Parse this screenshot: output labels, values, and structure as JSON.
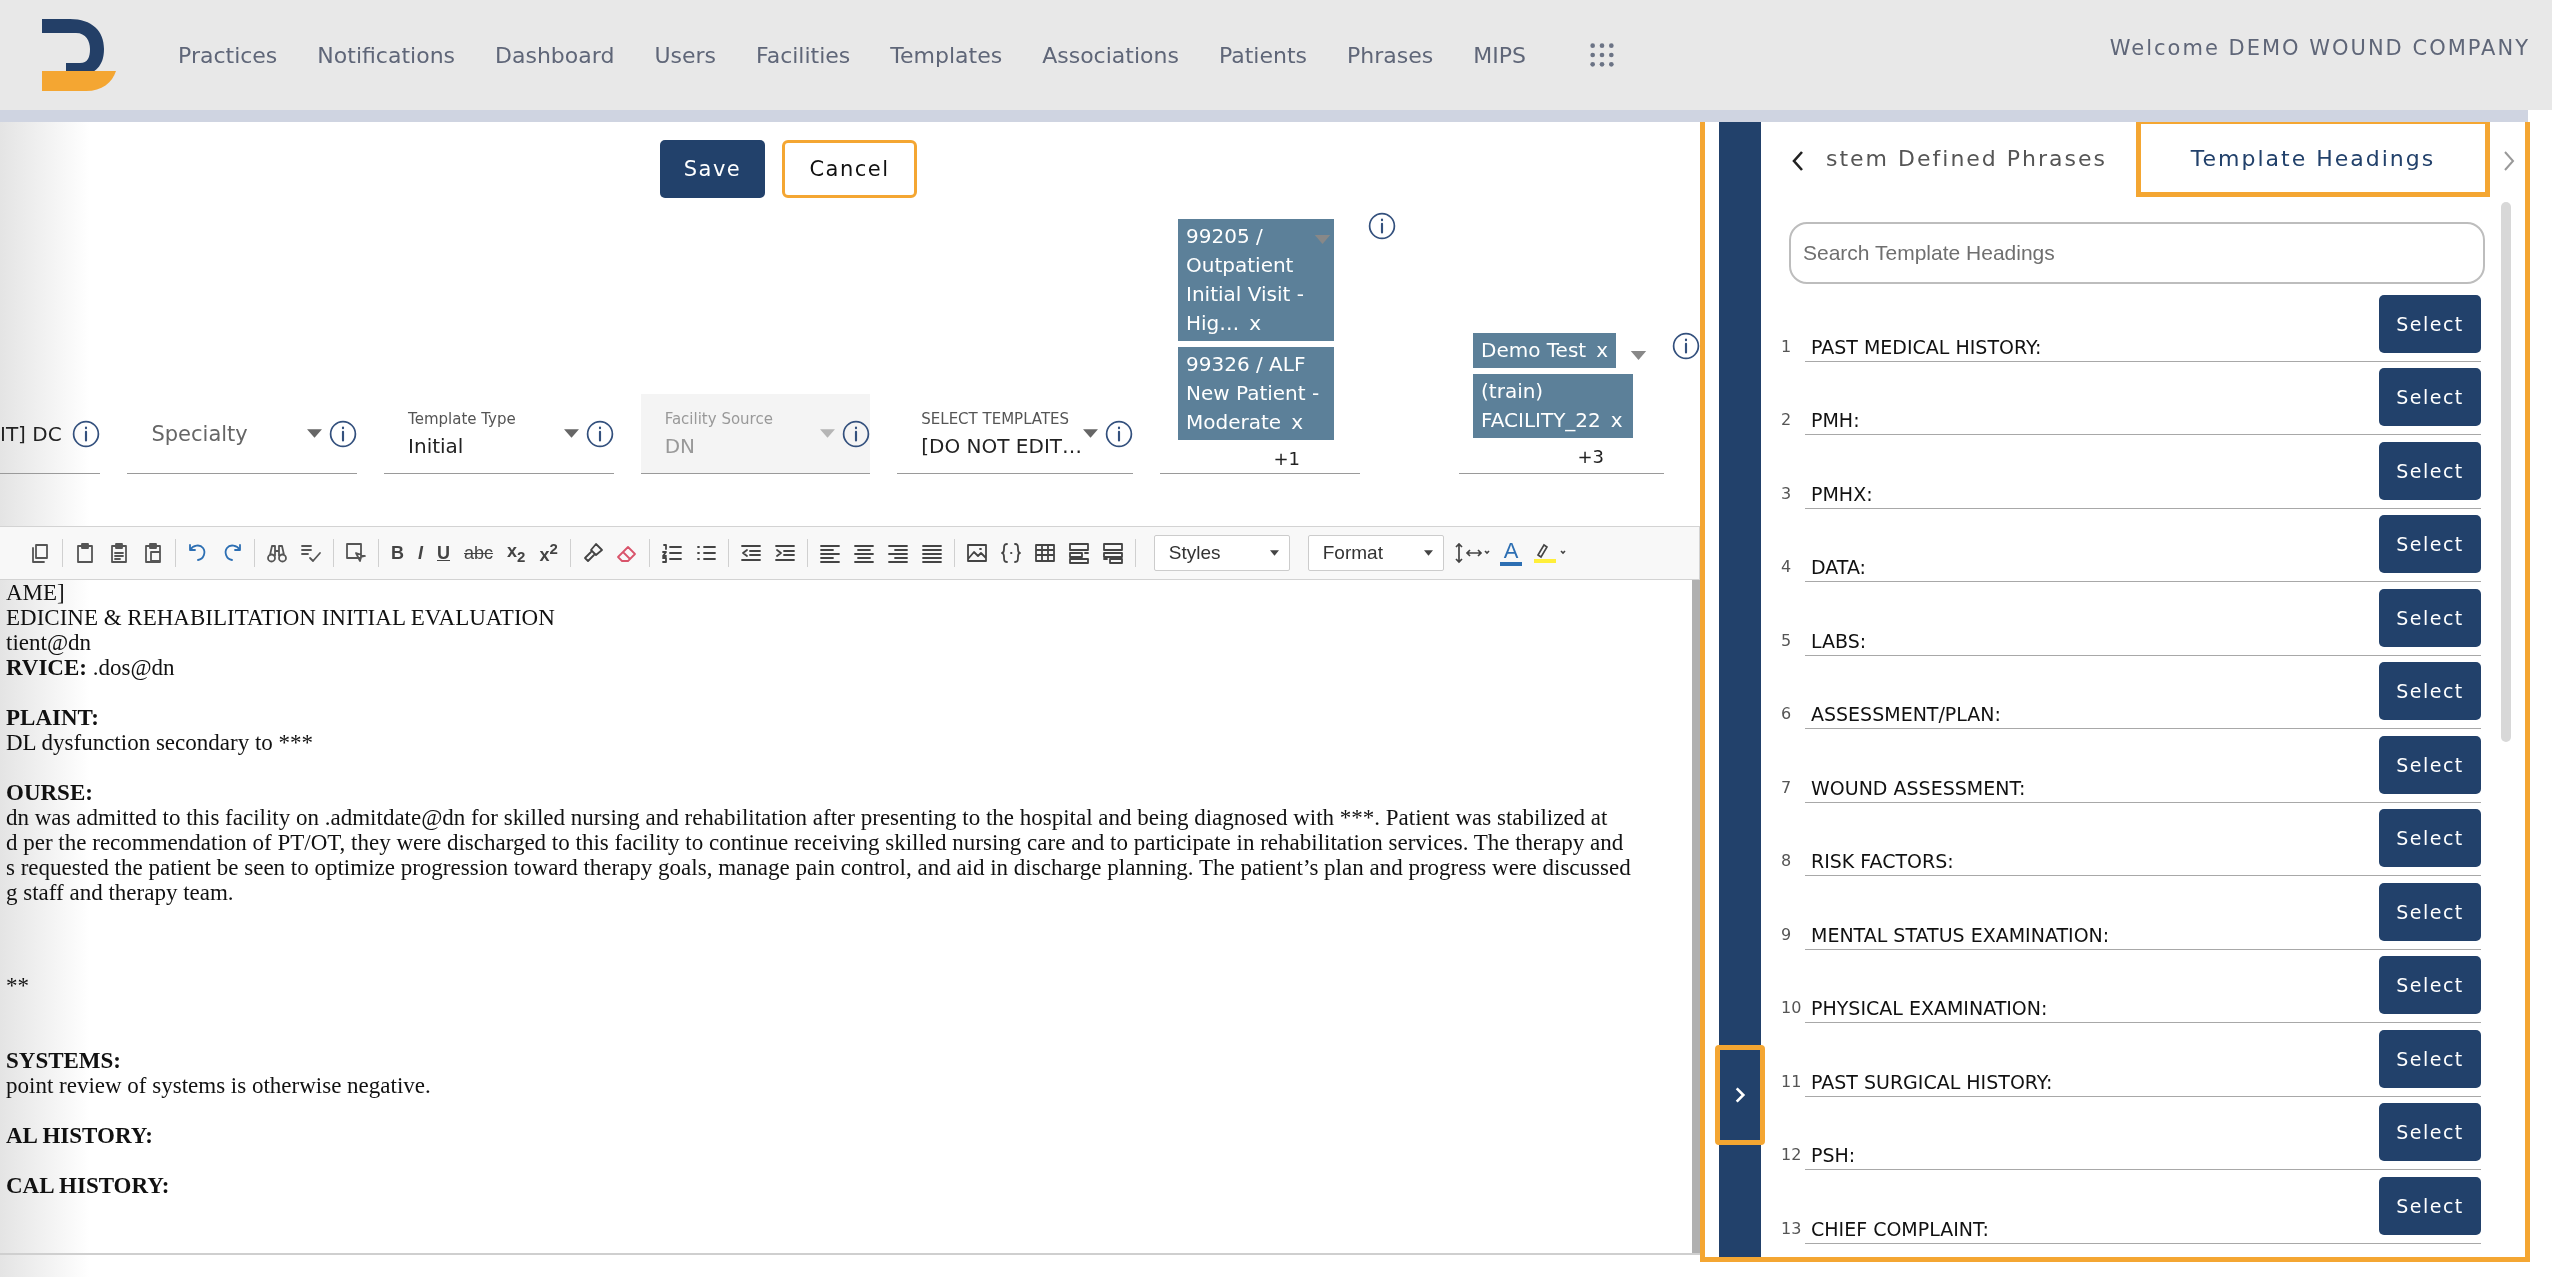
{
  "header": {
    "nav": [
      "Practices",
      "Notifications",
      "Dashboard",
      "Users",
      "Facilities",
      "Templates",
      "Associations",
      "Patients",
      "Phrases",
      "MIPS"
    ],
    "welcome": "Welcome DEMO WOUND COMPANY"
  },
  "actions": {
    "save": "Save",
    "cancel": "Cancel"
  },
  "fields": [
    {
      "kind": "text",
      "value": "IT] DC",
      "disabled": false
    },
    {
      "kind": "select",
      "placeholder": "Specialty",
      "disabled": false
    },
    {
      "kind": "select",
      "label": "Template Type",
      "value": "Initial",
      "disabled": false
    },
    {
      "kind": "select",
      "label": "Facility Source",
      "value": "DN",
      "disabled": true
    },
    {
      "kind": "select",
      "label": "SELECT TEMPLATES",
      "value": "[DO NOT EDIT…",
      "disabled": false
    }
  ],
  "chip_groups": [
    {
      "chips": [
        {
          "text": "99205 / Outpatient Initial Visit - Hig…",
          "remove": "x"
        },
        {
          "text": "99326 / ALF New Patient - Moderate",
          "remove": "x"
        }
      ],
      "more": "+1"
    },
    {
      "chips": [
        {
          "text": "Demo Test",
          "remove": "x"
        },
        {
          "text": "(train) FACILITY_22",
          "remove": "x"
        }
      ],
      "more": "+3"
    }
  ],
  "toolbar": {
    "text_buttons": [
      "B",
      "I",
      "U",
      "abc",
      "x$_{2}$",
      "x$^{2}$"
    ],
    "styles": "Styles",
    "format": "Format",
    "font_color": "A"
  },
  "editor": [
    [
      {
        "text": "AME]",
        "bold": false
      },
      {
        "text": "EDICINE & REHABILITATION INITIAL EVALUATION",
        "bold": false
      },
      {
        "text": "tient@dn",
        "bold": false
      },
      {
        "text": "**RVICE:** .dos@dn",
        "bold": false
      }
    ],
    [
      {
        "text": "PLAINT:",
        "bold": true
      },
      {
        "text": "DL dysfunction secondary to ***",
        "bold": false
      }
    ],
    [
      {
        "text": "OURSE:",
        "bold": true
      },
      {
        "text": "dn was admitted to this facility on .admitdate@dn for skilled nursing and rehabilitation after presenting to the hospital and being diagnosed with ***. Patient was stabilized at",
        "bold": false
      },
      {
        "text": "d per the recommendation of PT/OT, they were discharged to this facility to continue receiving skilled nursing care and to participate in rehabilitation services.  The therapy and",
        "bold": false
      },
      {
        "text": "s requested the patient be seen to optimize progression toward therapy goals, manage pain control, and aid in discharge planning. The patient’s plan and progress were discussed",
        "bold": false
      },
      {
        "text": "g staff and therapy team.",
        "bold": false
      }
    ],
    [
      {
        "text": "**",
        "bold": false
      }
    ],
    [
      {
        "text": "SYSTEMS:",
        "bold": true
      },
      {
        "text": "point review of systems is otherwise negative.",
        "bold": false
      }
    ],
    [
      {
        "text": "AL HISTORY:",
        "bold": true
      }
    ],
    [
      {
        "text": "CAL HISTORY:",
        "bold": true
      }
    ]
  ],
  "panel": {
    "tabs": [
      {
        "label": "stem Defined Phrases",
        "selected": false
      },
      {
        "label": "Template Headings",
        "selected": true
      }
    ],
    "search": {
      "placeholder": "Search Template Headings"
    },
    "headings": [
      {
        "number": "1",
        "label": "PAST MEDICAL HISTORY:",
        "button": "Select"
      },
      {
        "number": "2",
        "label": "PMH:",
        "button": "Select"
      },
      {
        "number": "3",
        "label": "PMHX:",
        "button": "Select"
      },
      {
        "number": "4",
        "label": "DATA:",
        "button": "Select"
      },
      {
        "number": "5",
        "label": "LABS:",
        "button": "Select"
      },
      {
        "number": "6",
        "label": "ASSESSMENT/PLAN:",
        "button": "Select"
      },
      {
        "number": "7",
        "label": "WOUND ASSESSMENT:",
        "button": "Select"
      },
      {
        "number": "8",
        "label": "RISK FACTORS:",
        "button": "Select"
      },
      {
        "number": "9",
        "label": "MENTAL STATUS EXAMINATION:",
        "button": "Select"
      },
      {
        "number": "10",
        "label": "PHYSICAL EXAMINATION:",
        "button": "Select"
      },
      {
        "number": "11",
        "label": "PAST SURGICAL HISTORY:",
        "button": "Select"
      },
      {
        "number": "12",
        "label": "PSH:",
        "button": "Select"
      },
      {
        "number": "13",
        "label": "CHIEF COMPLAINT:",
        "button": "Select"
      }
    ]
  }
}
